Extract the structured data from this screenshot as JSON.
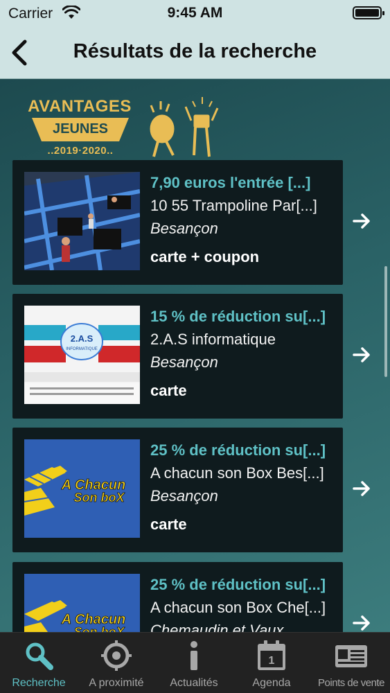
{
  "status_bar": {
    "carrier": "Carrier",
    "time": "9:45 AM"
  },
  "navbar": {
    "title": "Résultats de la recherche"
  },
  "banner": {
    "line1": "AVANTAGES",
    "line2": "JEUNES",
    "line3": "..2019·2020.."
  },
  "results": [
    {
      "offer": "7,90 euros l'entrée [...]",
      "name": "10 55 Trampoline Par[...]",
      "city": "Besançon",
      "type": "carte + coupon",
      "image": "trampoline-park-photo"
    },
    {
      "offer": "15 % de réduction su[...]",
      "name": "2.A.S informatique",
      "city": "Besançon",
      "type": "carte",
      "image": "2as-informatique-flyer"
    },
    {
      "offer": "25 % de réduction su[...]",
      "name": "A chacun son Box Bes[...]",
      "city": "Besançon",
      "type": "carte",
      "image": "a-chacun-son-box-logo"
    },
    {
      "offer": "25 % de réduction su[...]",
      "name": "A chacun son Box Che[...]",
      "city": "Chemaudin et Vaux",
      "type": "",
      "image": "a-chacun-son-box-logo"
    }
  ],
  "thumb_text": {
    "as_logo": "2.A.S",
    "as_sub": "INFORMATIQUE",
    "box_line1": "A Chacun",
    "box_line2": "Son boX"
  },
  "tabbar": [
    {
      "label": "Recherche",
      "icon": "search-icon",
      "active": true
    },
    {
      "label": "A proximité",
      "icon": "target-icon",
      "active": false
    },
    {
      "label": "Actualités",
      "icon": "info-icon",
      "active": false
    },
    {
      "label": "Agenda",
      "icon": "calendar-icon",
      "active": false
    },
    {
      "label": "Points de vente",
      "icon": "store-card-icon",
      "active": false
    }
  ],
  "colors": {
    "accent": "#5fc1c6",
    "banner_gold": "#e9bd55",
    "card_bg": "#0f1b1e",
    "header_bg": "#cfe3e3"
  }
}
